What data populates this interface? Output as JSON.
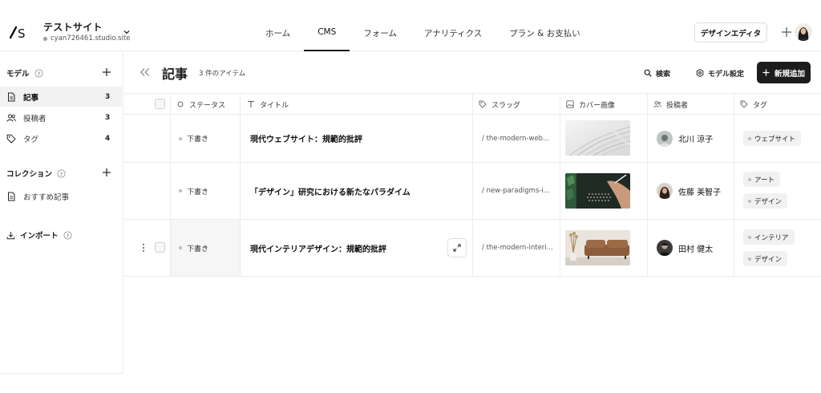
{
  "site": {
    "name": "テストサイト",
    "url": "cyan726461.studio.site",
    "logo_icon": "studio-logo-icon"
  },
  "nav": {
    "tabs": [
      {
        "label": "ホーム",
        "active": false
      },
      {
        "label": "CMS",
        "active": true
      },
      {
        "label": "フォーム",
        "active": false
      },
      {
        "label": "アナリティクス",
        "active": false
      },
      {
        "label": "プラン & お支払い",
        "active": false
      }
    ],
    "design_editor_label": "デザインエディタ"
  },
  "sidebar": {
    "models_title": "モデル",
    "models": [
      {
        "label": "記事",
        "count": "3",
        "icon": "document-icon",
        "active": true
      },
      {
        "label": "投稿者",
        "count": "3",
        "icon": "users-icon",
        "active": false
      },
      {
        "label": "タグ",
        "count": "4",
        "icon": "tag-icon",
        "active": false
      }
    ],
    "collections_title": "コレクション",
    "collections": [
      {
        "label": "おすすめ記事",
        "icon": "document-icon"
      }
    ],
    "import_label": "インポート"
  },
  "main": {
    "title": "記事",
    "item_count": "3 件のアイテム",
    "search_label": "検索",
    "model_settings_label": "モデル設定",
    "new_button_label": "新規追加"
  },
  "table": {
    "columns": {
      "status": "ステータス",
      "title": "タイトル",
      "slug": "スラッグ",
      "cover": "カバー画像",
      "author": "投稿者",
      "tags": "タグ"
    },
    "rows": [
      {
        "status": "下書き",
        "title": "現代ウェブサイト：規範的批評",
        "slug": "/ the-modern-web...",
        "author": "北川 涼子",
        "tags": [
          "ウェブサイト"
        ]
      },
      {
        "status": "下書き",
        "title": "「デザイン」研究における新たなパラダイム",
        "slug": "/ new-paradigms-i...",
        "author": "佐藤 美智子",
        "tags": [
          "アート",
          "デザイン"
        ]
      },
      {
        "status": "下書き",
        "title": "現代インテリアデザイン：規範的批評",
        "slug": "/ the-modern-interi...",
        "author": "田村 健太",
        "tags": [
          "インテリア",
          "デザイン"
        ]
      }
    ]
  },
  "colors": {
    "accent": "#1c1c1c",
    "border": "#ececec",
    "status_dot": "#bdbdbd"
  }
}
